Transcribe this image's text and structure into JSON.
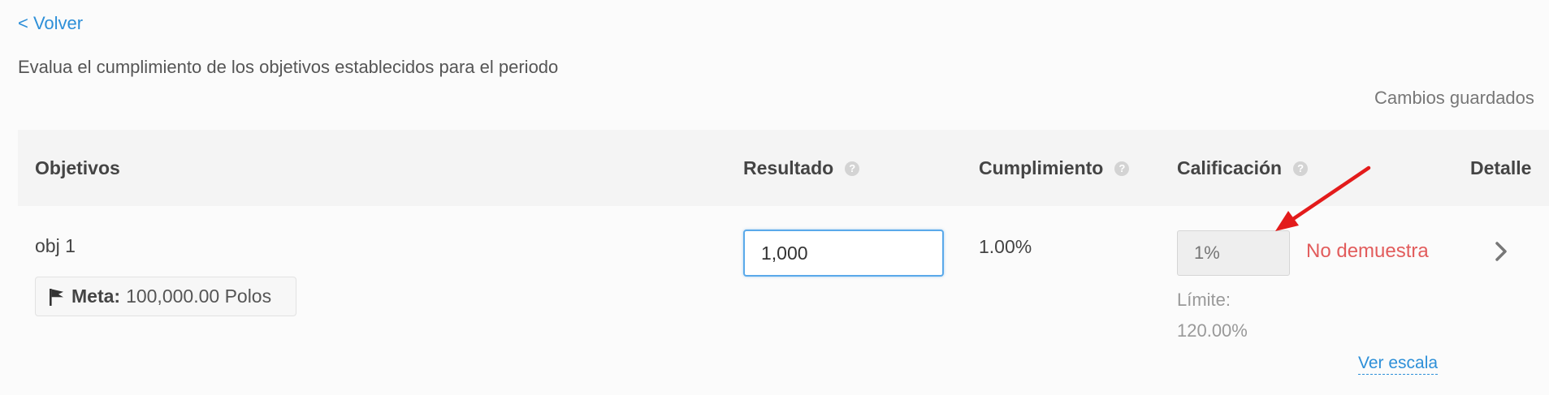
{
  "nav": {
    "back_label": "< Volver"
  },
  "page": {
    "subtitle": "Evalua el cumplimiento de los objetivos establecidos para el periodo",
    "save_status": "Cambios guardados"
  },
  "table": {
    "headers": {
      "objectives": "Objetivos",
      "result": "Resultado",
      "compliance": "Cumplimiento",
      "rating": "Calificación",
      "detail": "Detalle"
    },
    "help_glyph": "?",
    "rows": [
      {
        "name": "obj 1",
        "meta_label": "Meta:",
        "meta_value": "100,000.00 Polos",
        "result_value": "1,000",
        "compliance": "1.00%",
        "rating_placeholder": "1%",
        "rating_status": "No demuestra",
        "limit_label": "Límite:",
        "limit_value": "120.00%",
        "scale_link": "Ver escala"
      }
    ]
  },
  "icons": {
    "flag": "flag-icon",
    "help": "help-icon",
    "chevron": "chevron-right-icon",
    "annotation": "red-arrow-annotation"
  },
  "colors": {
    "link": "#2d8fd8",
    "status_negative": "#e25c5c",
    "input_focus_border": "#5aa9ea",
    "annotation_arrow": "#e31b1b"
  }
}
